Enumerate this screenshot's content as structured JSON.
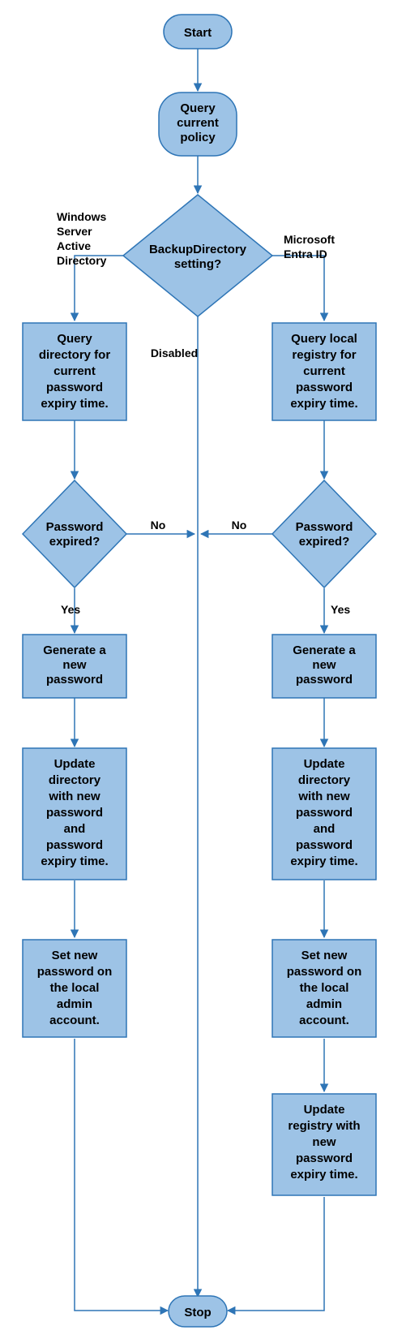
{
  "colors": {
    "fill": "#9dc3e6",
    "stroke": "#2e75b6",
    "line": "#2e75b6"
  },
  "nodes": {
    "start": "Start",
    "query_policy_l1": "Query",
    "query_policy_l2": "current",
    "query_policy_l3": "policy",
    "decision_l1": "BackupDirectory",
    "decision_l2": "setting?",
    "left_branch_label_l1": "Windows",
    "left_branch_label_l2": "Server",
    "left_branch_label_l3": "Active",
    "left_branch_label_l4": "Directory",
    "right_branch_label_l1": "Microsoft",
    "right_branch_label_l2": "Entra ID",
    "center_branch_label": "Disabled",
    "left_query_l1": "Query",
    "left_query_l2": "directory for",
    "left_query_l3": "current",
    "left_query_l4": "password",
    "left_query_l5": "expiry time.",
    "right_query_l1": "Query local",
    "right_query_l2": "registry for",
    "right_query_l3": "current",
    "right_query_l4": "password",
    "right_query_l5": "expiry time.",
    "pw_expired_l1": "Password",
    "pw_expired_l2": "expired?",
    "no": "No",
    "yes": "Yes",
    "gen_l1": "Generate a",
    "gen_l2": "new",
    "gen_l3": "password",
    "upd_dir_l1": "Update",
    "upd_dir_l2": "directory",
    "upd_dir_l3": "with new",
    "upd_dir_l4": "password",
    "upd_dir_l5": "and",
    "upd_dir_l6": "password",
    "upd_dir_l7": "expiry time.",
    "set_local_l1": "Set new",
    "set_local_l2": "password on",
    "set_local_l3": "the local",
    "set_local_l4": "admin",
    "set_local_l5": "account.",
    "upd_reg_l1": "Update",
    "upd_reg_l2": "registry with",
    "upd_reg_l3": "new",
    "upd_reg_l4": "password",
    "upd_reg_l5": "expiry time.",
    "stop": "Stop"
  }
}
